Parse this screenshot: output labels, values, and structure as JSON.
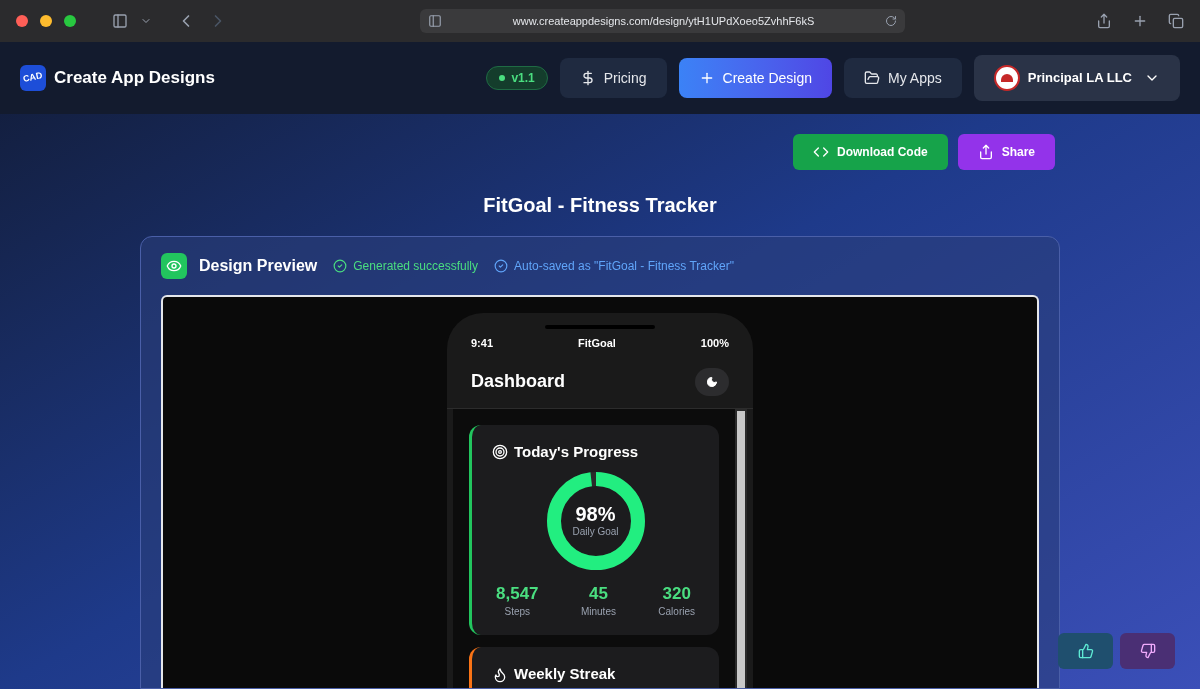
{
  "browser": {
    "url": "www.createappdesigns.com/design/ytH1UPdXoeo5ZvhhF6kS"
  },
  "header": {
    "logo_text": "CAD",
    "title": "Create App Designs",
    "version": "v1.1",
    "nav": [
      {
        "label": "Pricing",
        "kind": "pricing"
      },
      {
        "label": "Create Design",
        "kind": "create"
      },
      {
        "label": "My Apps",
        "kind": "apps"
      }
    ],
    "account": {
      "name": "Principal LA LLC"
    }
  },
  "actions": [
    {
      "label": "Download Code",
      "kind": "download"
    },
    {
      "label": "Share",
      "kind": "share"
    }
  ],
  "project_title": "FitGoal - Fitness Tracker",
  "preview": {
    "title": "Design Preview",
    "statuses": [
      {
        "text": "Generated successfully",
        "kind": "success"
      },
      {
        "text": "Auto-saved as \"FitGoal - Fitness Tracker\"",
        "kind": "saved"
      }
    ],
    "phone": {
      "time": "9:41",
      "app_name": "FitGoal",
      "battery": "100%",
      "screen_title": "Dashboard",
      "cards": [
        {
          "kind": "progress",
          "title": "Today's Progress",
          "level": 0.98,
          "percent": "98%",
          "caption": "Daily Goal",
          "stats": [
            {
              "value": "8,547",
              "label": "Steps"
            },
            {
              "value": "45",
              "label": "Minutes"
            },
            {
              "value": "320",
              "label": "Calories"
            }
          ]
        },
        {
          "kind": "streak",
          "title": "Weekly Streak"
        }
      ]
    }
  }
}
